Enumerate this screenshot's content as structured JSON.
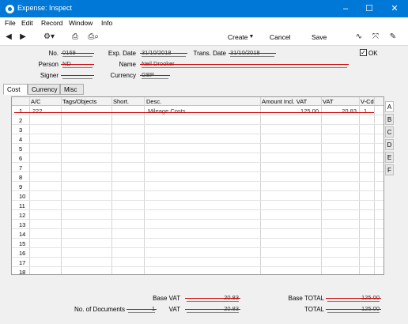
{
  "window": {
    "title": "Expense: Inspect",
    "controls": {
      "minimize": "–",
      "maximize": "☐",
      "close": "✕"
    }
  },
  "menu": [
    "File",
    "Edit",
    "Record",
    "Window",
    "Info"
  ],
  "toolbar": {
    "create_label": "Create",
    "cancel_label": "Cancel",
    "save_label": "Save"
  },
  "header": {
    "no_label": "No.",
    "no_value": "0169",
    "exp_date_label": "Exp. Date",
    "exp_date_value": "31/10/2018",
    "trans_date_label": "Trans. Date",
    "trans_date_value": "31/10/2018",
    "ok_label": "OK",
    "ok_checked": "✓",
    "person_label": "Person",
    "person_value": "ND",
    "name_label": "Name",
    "name_value": "Neil Drooker",
    "signer_label": "Signer",
    "signer_value": "",
    "currency_label": "Currency",
    "currency_value": "GBP"
  },
  "tabs": [
    "Cost",
    "Currency",
    "Misc"
  ],
  "grid": {
    "columns": [
      "A/C",
      "Tags/Objects",
      "Short.",
      "Desc.",
      "Amount Incl. VAT",
      "VAT",
      "V-Cd"
    ],
    "rows": [
      {
        "n": "1",
        "ac": "222",
        "tags": "",
        "short": "",
        "desc": "Mileage Costs",
        "amount": "125.00",
        "vat": "20.83",
        "vcd": "1"
      },
      {
        "n": "2"
      },
      {
        "n": "3"
      },
      {
        "n": "4"
      },
      {
        "n": "5"
      },
      {
        "n": "6"
      },
      {
        "n": "7"
      },
      {
        "n": "8"
      },
      {
        "n": "9"
      },
      {
        "n": "10"
      },
      {
        "n": "11"
      },
      {
        "n": "12"
      },
      {
        "n": "13"
      },
      {
        "n": "14"
      },
      {
        "n": "15"
      },
      {
        "n": "16"
      },
      {
        "n": "17"
      },
      {
        "n": "18"
      }
    ]
  },
  "side_tabs": [
    "A",
    "B",
    "C",
    "D",
    "E",
    "F"
  ],
  "totals": {
    "base_vat_label": "Base VAT",
    "base_vat_value": "20.83",
    "vat_label": "VAT",
    "vat_value": "20.83",
    "no_docs_label": "No. of Documents",
    "no_docs_value": "1",
    "base_total_label": "Base TOTAL",
    "base_total_value": "125.00",
    "total_label": "TOTAL",
    "total_value": "125.00"
  },
  "colors": {
    "titlebar": "#0078d7",
    "strike": "#d20000"
  }
}
